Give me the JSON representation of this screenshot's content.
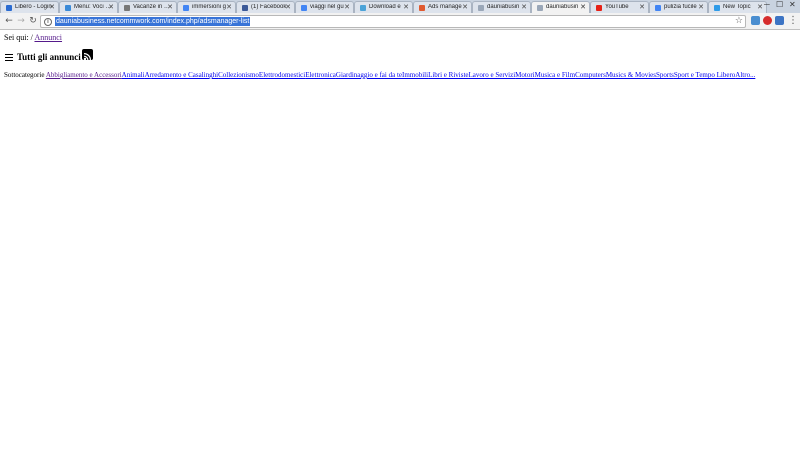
{
  "browser": {
    "tabs": [
      {
        "title": "Libero - Login",
        "favicon_color": "#2a6bd1"
      },
      {
        "title": "Menu: Voci di m",
        "favicon_color": "#3a8ad8"
      },
      {
        "title": "Vacanze in Pu",
        "favicon_color": "#777777"
      },
      {
        "title": "immersioni g",
        "favicon_color": "#4285f4"
      },
      {
        "title": "(1) Facebook",
        "favicon_color": "#3b5998"
      },
      {
        "title": "viaggi nel gu",
        "favicon_color": "#4285f4"
      },
      {
        "title": "Download e",
        "favicon_color": "#4ba3d8"
      },
      {
        "title": "Ads manage",
        "favicon_color": "#e05a30"
      },
      {
        "title": "dauniabusin",
        "favicon_color": "#9aa7b8"
      },
      {
        "title": "dauniabusin",
        "favicon_color": "#9aa7b8"
      },
      {
        "title": "YouTube",
        "favicon_color": "#e62117"
      },
      {
        "title": "pulizia fucile",
        "favicon_color": "#4285f4"
      },
      {
        "title": "New Topic",
        "favicon_color": "#2e9be8"
      }
    ],
    "active_tab_index": 9,
    "url": "dauniabusiness.netcommwork.com/index.php/adsmanager-list",
    "extension_colors": [
      "#4a8ed0",
      "#d62c2c",
      "#3c74c4",
      "#555555"
    ]
  },
  "page": {
    "breadcrumb_label": "Sei qui:",
    "breadcrumb_sep": "/",
    "breadcrumb_link": "Annunci",
    "heading": "Tutti gli annunci",
    "subcategories_label": "Sottocategorie",
    "categories": [
      "Abbigliamento e Accessori",
      "Animali",
      "Arredamento e Casalinghi",
      "Collezionismo",
      "Elettrodomestici",
      "Elettronica",
      "Giardinaggio e fai da te",
      "Immobili",
      "Libri e Riviste",
      "Lavoro e Servizi",
      "Motori",
      "Musica e Film",
      "Computers",
      "Musics & Movies",
      "Sports",
      "Sport e Tempo Libero",
      "Altro..."
    ]
  }
}
